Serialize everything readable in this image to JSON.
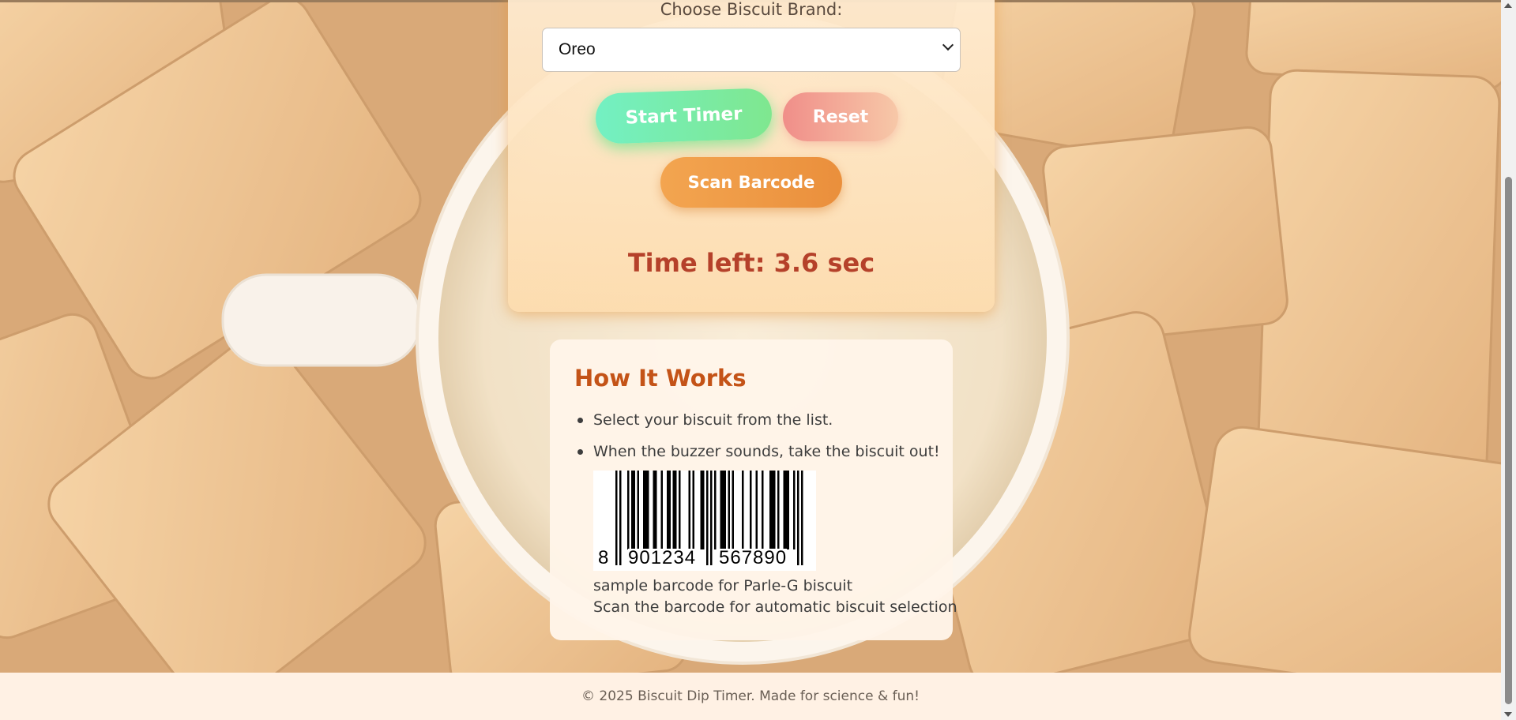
{
  "panel": {
    "brand_label": "Choose Biscuit Brand:",
    "selected_brand": "Oreo",
    "buttons": {
      "start": "Start Timer",
      "reset": "Reset",
      "scan": "Scan Barcode"
    },
    "time_left": "Time left: 3.6 sec"
  },
  "how_it_works": {
    "title": "How It Works",
    "steps": [
      "Select your biscuit from the list.",
      "When the buzzer sounds, take the biscuit out!"
    ],
    "barcode": {
      "first_digit": "8",
      "left_digits": "901234",
      "right_digits": "567890"
    },
    "captions": [
      "sample barcode for Parle-G biscuit",
      "Scan the barcode for automatic biscuit selection"
    ]
  },
  "footer": {
    "text": "© 2025 Biscuit Dip Timer. Made for science & fun!"
  },
  "colors": {
    "title_accent": "#c45317",
    "time_text": "#b5412a",
    "start_button": "#73f0c3",
    "reset_button": "#f08e89",
    "scan_button": "#ea8f3c",
    "footer_bg": "#fff1e4"
  }
}
